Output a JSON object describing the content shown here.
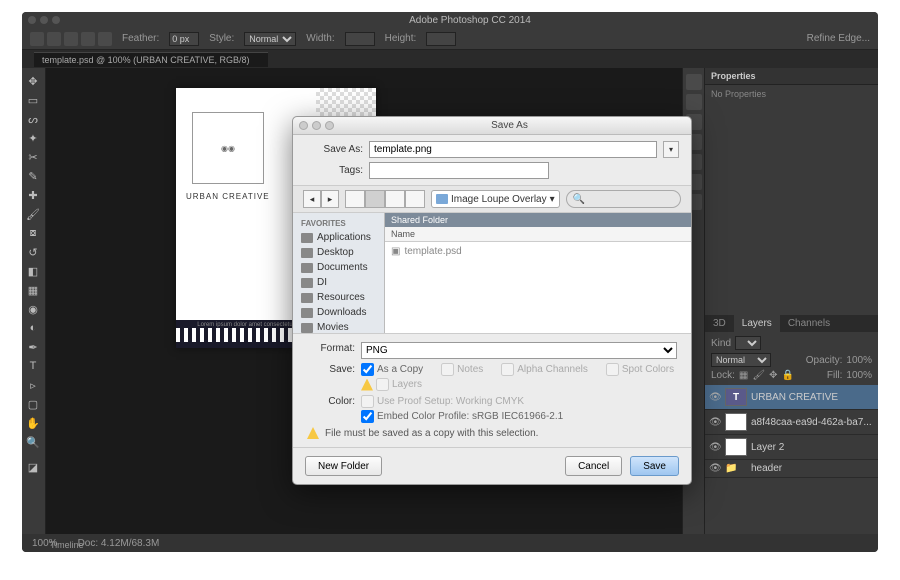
{
  "app": {
    "title": "Adobe Photoshop CC 2014"
  },
  "options": {
    "feather_label": "Feather:",
    "feather_value": "0 px",
    "style_label": "Style:",
    "style_value": "Normal",
    "width_label": "Width:",
    "height_label": "Height:",
    "refine_label": "Refine Edge..."
  },
  "doc_tab": "template.psd @ 100% (URBAN CREATIVE, RGB/8)",
  "status": {
    "zoom": "100%",
    "docinfo": "Doc: 4.12M/68.3M",
    "timeline": "Timeline"
  },
  "canvas": {
    "logo_text": "URBAN CREATIVE",
    "footer_text": "Lorem ipsum dolor amet consectetur"
  },
  "panels": {
    "properties_tab": "Properties",
    "no_props": "No Properties",
    "tabs": {
      "threeD": "3D",
      "layers": "Layers",
      "channels": "Channels"
    },
    "kind_label": "Kind",
    "blend_value": "Normal",
    "opacity_label": "Opacity:",
    "opacity_value": "100%",
    "lock_label": "Lock:",
    "fill_label": "Fill:",
    "fill_value": "100%"
  },
  "layers": [
    {
      "name": "URBAN CREATIVE",
      "type": "T",
      "selected": true
    },
    {
      "name": "a8f48caa-ea9d-462a-ba7...",
      "type": "img",
      "selected": false
    },
    {
      "name": "Layer 2",
      "type": "img",
      "selected": false
    },
    {
      "name": "header",
      "type": "folder",
      "selected": false
    }
  ],
  "dialog": {
    "title": "Save As",
    "saveas_label": "Save As:",
    "saveas_value": "template.png",
    "tags_label": "Tags:",
    "path_label": "Image Loupe Overlay",
    "search_placeholder": "",
    "favorites_label": "FAVORITES",
    "favorites": [
      "Applications",
      "Desktop",
      "Documents",
      "DI",
      "Resources",
      "Downloads",
      "Movies"
    ],
    "shared_header": "Shared Folder",
    "col_name": "Name",
    "file_item": "template.psd",
    "format_label": "Format:",
    "format_value": "PNG",
    "save_label": "Save:",
    "checks": {
      "as_copy": "As a Copy",
      "notes": "Notes",
      "alpha": "Alpha Channels",
      "spot": "Spot Colors",
      "layers": "Layers"
    },
    "color_label": "Color:",
    "proof": "Use Proof Setup:  Working CMYK",
    "embed": "Embed Color Profile:  sRGB IEC61966-2.1",
    "warning": "File must be saved as a copy with this selection.",
    "new_folder": "New Folder",
    "cancel": "Cancel",
    "save_btn": "Save"
  }
}
